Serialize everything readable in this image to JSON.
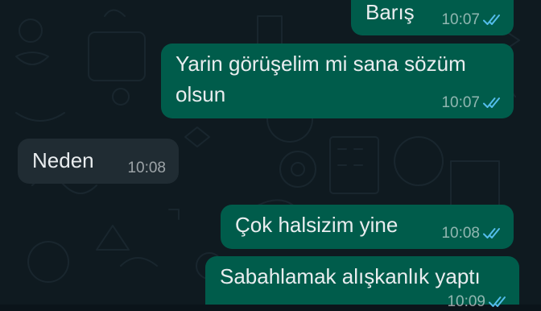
{
  "colors": {
    "chat_background": "#0f1a20",
    "outgoing_bubble": "#005c4b",
    "incoming_bubble": "#202c33",
    "text": "#e9edef",
    "read_ticks": "#53bdeb"
  },
  "messages": [
    {
      "direction": "outgoing",
      "text": "Barış",
      "time": "10:07",
      "status": "read"
    },
    {
      "direction": "outgoing",
      "text": "Yarin görüşelim mi sana sözüm olsun",
      "time": "10:07",
      "status": "read"
    },
    {
      "direction": "incoming",
      "text": "Neden",
      "time": "10:08"
    },
    {
      "direction": "outgoing",
      "text": "Çok halsizim yine",
      "time": "10:08",
      "status": "read"
    },
    {
      "direction": "outgoing",
      "text": "Sabahlamak alışkanlık yaptı",
      "time": "10:09",
      "status": "read"
    }
  ]
}
